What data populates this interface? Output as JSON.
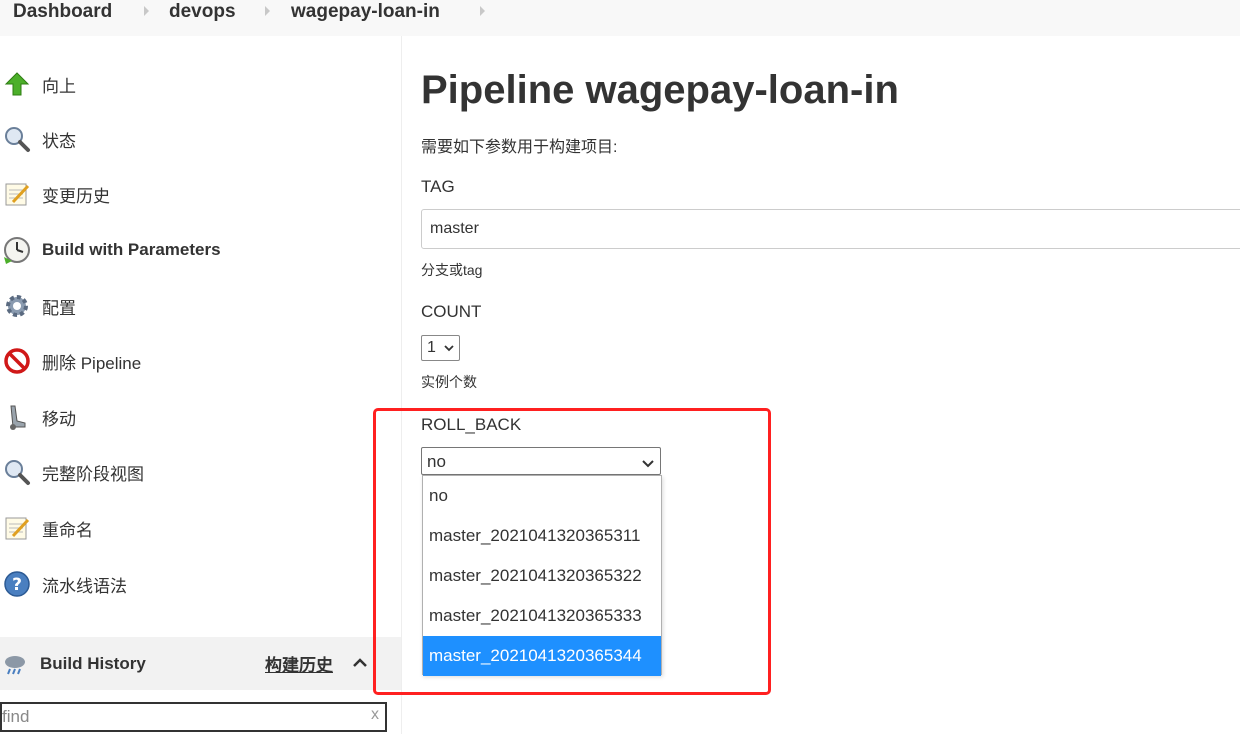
{
  "breadcrumb": {
    "items": [
      "Dashboard",
      "devops",
      "wagepay-loan-in"
    ]
  },
  "side_panel": {
    "tasks": [
      {
        "label": "向上",
        "icon": "up-arrow-icon"
      },
      {
        "label": "状态",
        "icon": "magnifier-icon"
      },
      {
        "label": "变更历史",
        "icon": "notepad-icon"
      },
      {
        "label": "Build with Parameters",
        "icon": "clock-icon"
      },
      {
        "label": "配置",
        "icon": "gear-icon"
      },
      {
        "label": "删除 Pipeline",
        "icon": "no-entry-icon"
      },
      {
        "label": "移动",
        "icon": "move-icon"
      },
      {
        "label": "完整阶段视图",
        "icon": "magnifier-icon"
      },
      {
        "label": "重命名",
        "icon": "notepad-icon"
      },
      {
        "label": "流水线语法",
        "icon": "help-icon"
      }
    ],
    "build_history": {
      "title": "Build History",
      "link": "构建历史",
      "icon": "weather-icon"
    },
    "find": {
      "placeholder": "find",
      "clear": "x"
    }
  },
  "main": {
    "title": "Pipeline wagepay-loan-in",
    "description": "需要如下参数用于构建项目:",
    "params": {
      "tag": {
        "name": "TAG",
        "value": "master",
        "description": "分支或tag"
      },
      "count": {
        "name": "COUNT",
        "value": "1",
        "description": "实例个数"
      },
      "roll_back": {
        "name": "ROLL_BACK",
        "value": "no",
        "options": [
          "no",
          "master_2021041320365311",
          "master_2021041320365322",
          "master_2021041320365333",
          "master_2021041320365344"
        ],
        "highlighted_option": "master_2021041320365344"
      }
    }
  },
  "colors": {
    "highlight_box": "#ff2020",
    "selected_option": "#1e90ff"
  }
}
